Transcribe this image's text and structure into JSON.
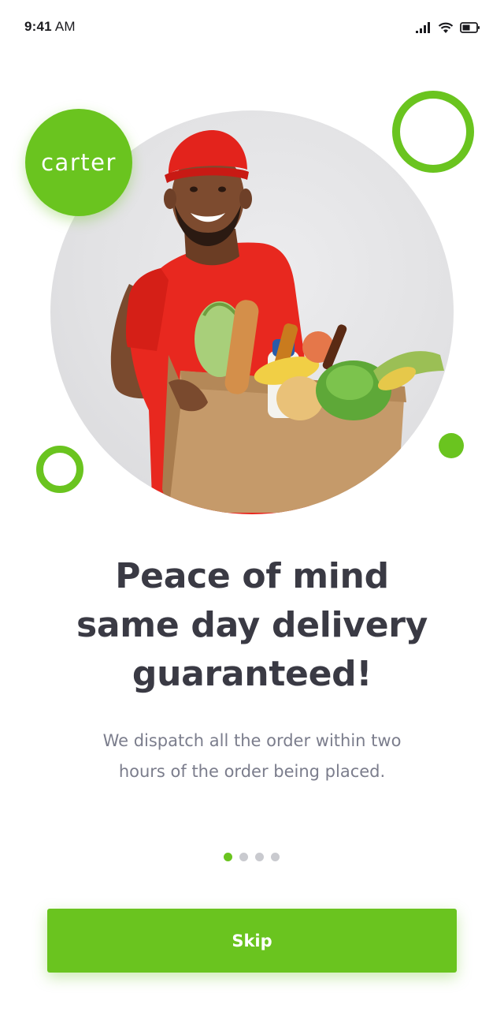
{
  "status_bar": {
    "time_bold": "9:41",
    "time_suffix": " AM",
    "icons": [
      "cellular-signal-icon",
      "wifi-icon",
      "battery-icon"
    ]
  },
  "brand": {
    "logo_text": "carter",
    "accent_color": "#6ac41f"
  },
  "hero": {
    "illustration": "delivery-man-with-grocery-box"
  },
  "onboarding": {
    "headline_lines": [
      "Peace of mind",
      "same day delivery",
      "guaranteed!"
    ],
    "subtext_lines": [
      "We dispatch all the order within two",
      "hours of the order being placed."
    ],
    "page_count": 4,
    "current_page": 1
  },
  "actions": {
    "skip_label": "Skip"
  }
}
